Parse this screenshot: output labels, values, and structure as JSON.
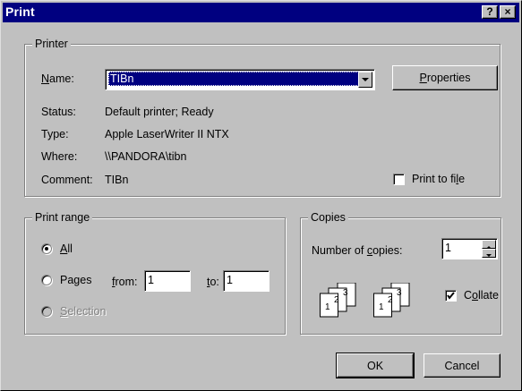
{
  "window": {
    "title": "Print",
    "help_button": "?",
    "close_button": "×"
  },
  "printer": {
    "group_label": "Printer",
    "name_label": "Name:",
    "name_value": "TIBn",
    "properties_button": "Properties",
    "status_label": "Status:",
    "status_value": "Default printer; Ready",
    "type_label": "Type:",
    "type_value": "Apple LaserWriter II NTX",
    "where_label": "Where:",
    "where_value": "\\\\PANDORA\\tibn",
    "comment_label": "Comment:",
    "comment_value": "TIBn",
    "print_to_file_label": "Print to file",
    "print_to_file_checked": false
  },
  "print_range": {
    "group_label": "Print range",
    "all_label": "All",
    "pages_label": "Pages",
    "from_label": "from:",
    "from_value": "1",
    "to_label": "to:",
    "to_value": "1",
    "selection_label": "Selection",
    "selected": "All"
  },
  "copies": {
    "group_label": "Copies",
    "number_label": "Number of copies:",
    "number_value": "1",
    "collate_label": "Collate",
    "collate_checked": true,
    "page_numbers": [
      "1",
      "2",
      "3"
    ]
  },
  "footer": {
    "ok_button": "OK",
    "cancel_button": "Cancel"
  },
  "colors": {
    "face": "#c0c0c0",
    "title_bar": "#000080",
    "selection": "#000080"
  }
}
